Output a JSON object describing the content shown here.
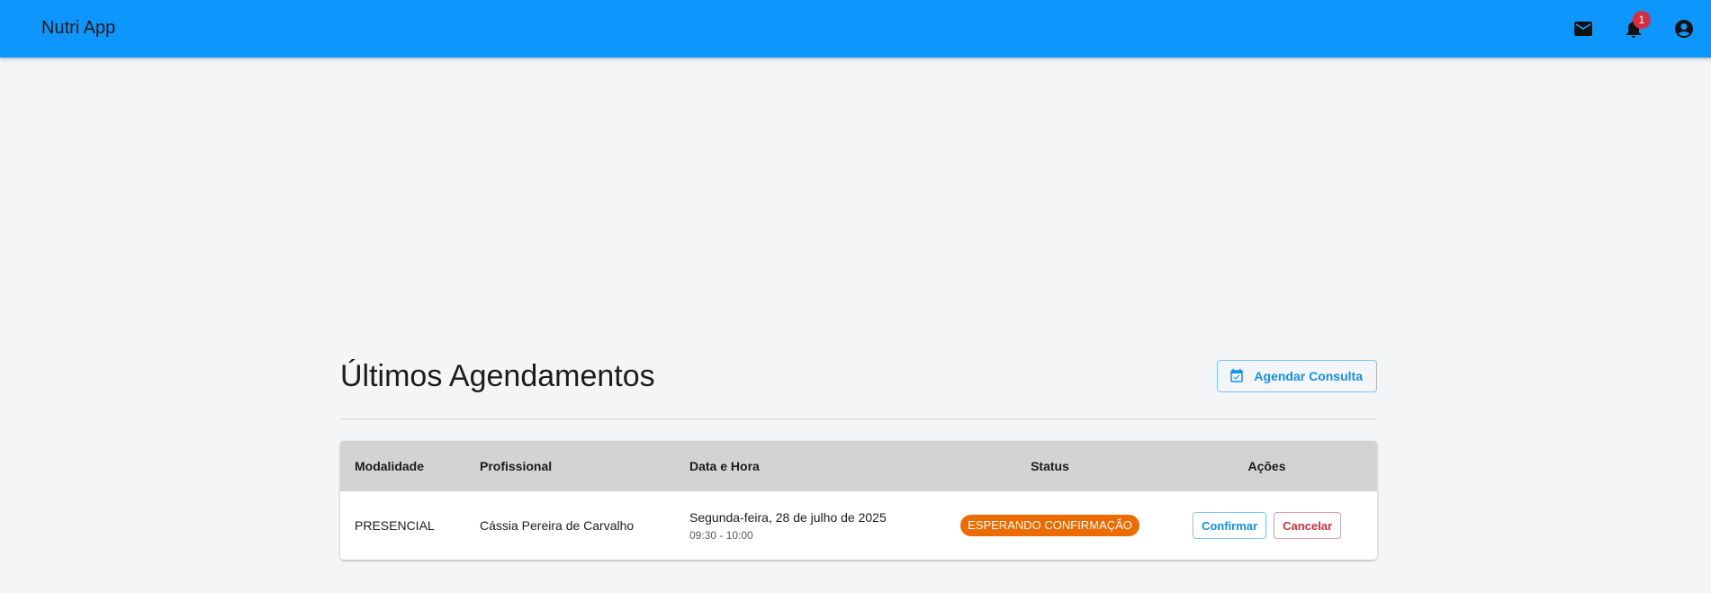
{
  "appbar": {
    "title": "Nutri App",
    "mail_icon": "mail-icon",
    "notifications_icon": "bell-icon",
    "notifications_count": "1",
    "account_icon": "account-circle-icon",
    "color": "#0d96fc"
  },
  "section": {
    "title": "Últimos Agendamentos",
    "schedule_button_label": "Agendar Consulta",
    "schedule_button_icon": "calendar-check-icon"
  },
  "table": {
    "headers": {
      "modality": "Modalidade",
      "professional": "Profissional",
      "datetime": "Data e Hora",
      "status": "Status",
      "actions": "Ações"
    },
    "rows": [
      {
        "modality": "PRESENCIAL",
        "professional": "Cássia Pereira de Carvalho",
        "date": "Segunda-feira, 28 de julho de 2025",
        "time": "09:30 - 10:00",
        "status": "ESPERANDO CONFIRMAÇÃO",
        "status_color": "#ed6c02",
        "confirm_label": "Confirmar",
        "cancel_label": "Cancelar"
      }
    ]
  }
}
